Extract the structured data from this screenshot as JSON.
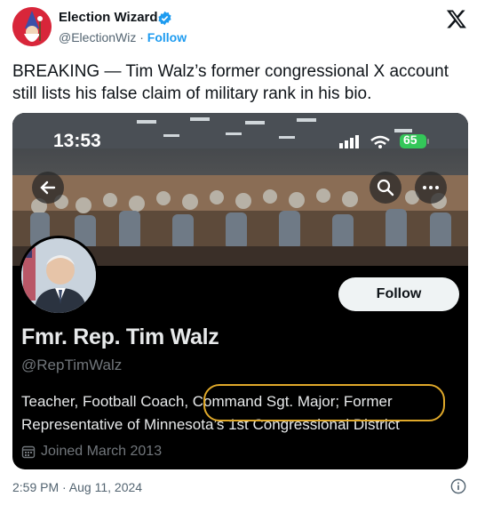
{
  "tweet": {
    "author_name": "Election Wizard",
    "author_handle": "@ElectionWiz",
    "separator": "·",
    "follow_label": "Follow",
    "text": "BREAKING — Tim Walz’s former congressional X account still lists his false claim of military rank in his bio.",
    "timestamp": "2:59 PM · Aug 11, 2024"
  },
  "screenshot": {
    "status_time": "13:53",
    "battery": "65",
    "profile": {
      "name": "Fmr. Rep. Tim Walz",
      "handle": "@RepTimWalz",
      "follow_label": "Follow",
      "bio": "Teacher, Football Coach, Command Sgt. Major; Former Representative of Minnesota’s 1st Congressional District",
      "joined": "Joined March 2013"
    }
  },
  "icons": {
    "verified": "verified-badge-icon",
    "x_logo": "x-logo-icon",
    "info": "info-icon",
    "back": "back-arrow-icon",
    "search": "search-icon",
    "more": "more-icon",
    "calendar": "calendar-icon"
  },
  "colors": {
    "link": "#1d9bf0",
    "highlight": "#e0a92a",
    "card_bg": "#000000"
  }
}
